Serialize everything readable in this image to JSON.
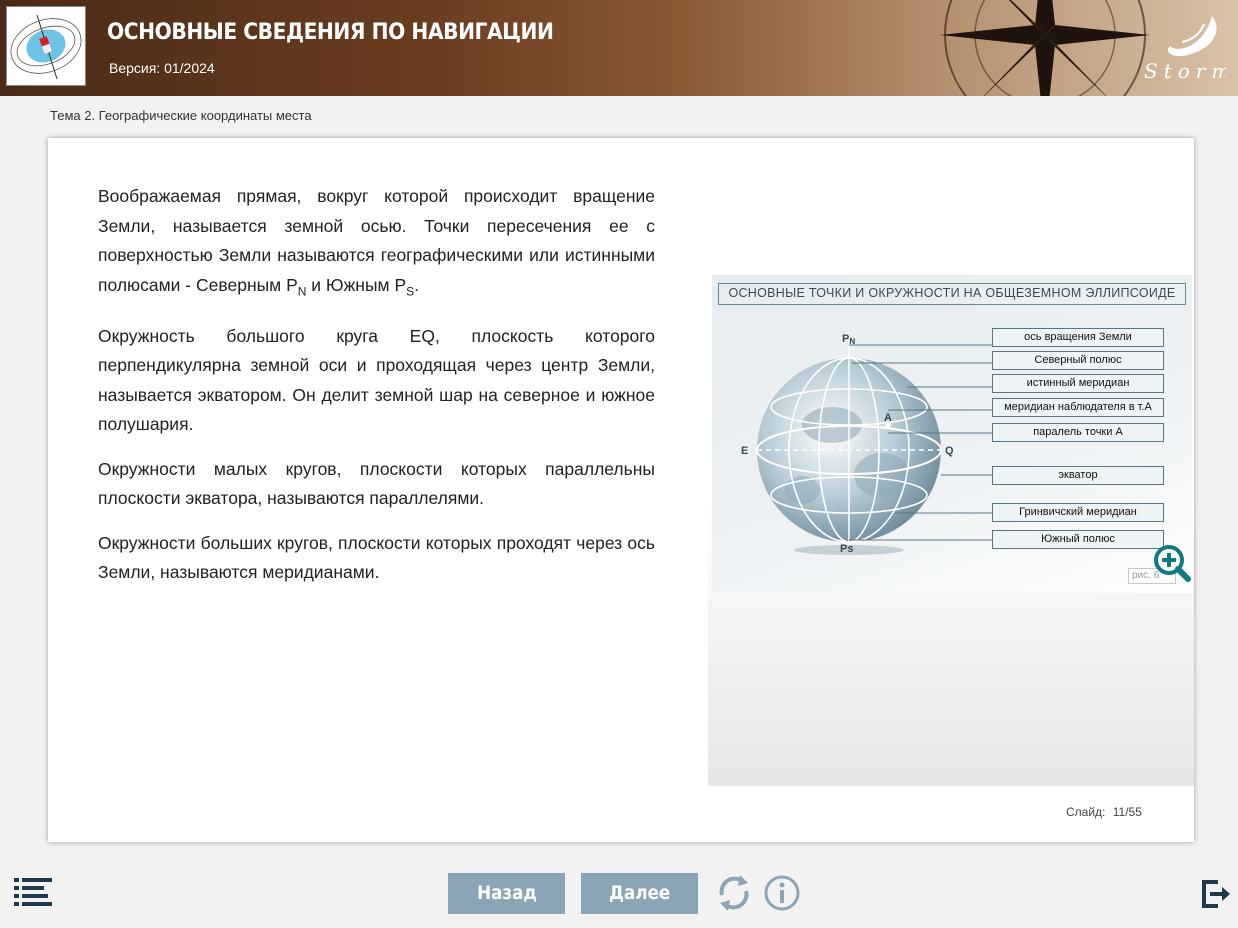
{
  "header": {
    "title": "ОСНОВНЫЕ СВЕДЕНИЯ ПО НАВИГАЦИИ",
    "version": "Версия: 01/2024",
    "brand": "Storm"
  },
  "topic": "Тема 2. Географические координаты места",
  "content": {
    "p1_text": "Воображаемая прямая, вокруг которой происходит вращение Земли, называется земной осью. Точки пересечения ее с поверхностью Земли называются географическими или истинными полюсами - Северным P",
    "p1_sub1": "N",
    "p1_mid": " и Южным P",
    "p1_sub2": "S",
    "p1_end": ".",
    "p2": "Окружность большого круга EQ, плоскость которого перпендикулярна земной оси и проходящая через центр Земли, называется экватором. Он делит земной шар на северное и южное полушария.",
    "p3": "Окружности малых кругов, плоскости которых параллельны плоскости экватора, называются параллелями.",
    "p4": "Окружности больших кругов, плоскости которых проходят через ось Земли, называются меридианами."
  },
  "figure": {
    "title": "ОСНОВНЫЕ ТОЧКИ И ОКРУЖНОСТИ НА ОБЩЕЗЕМНОМ ЭЛЛИПСОИДЕ",
    "points": {
      "pn": "P",
      "pn_sub": "N",
      "ps": "Ps",
      "a": "A",
      "e": "E",
      "q": "Q"
    },
    "labels": [
      "ось вращения Земли",
      "Северный полюс",
      "истинный меридиан",
      "меридиан наблюдателя в т.А",
      "паралель точки А",
      "экватор",
      "Гринвичский меридиан",
      "Южный полюс"
    ],
    "caption": "рис. 6"
  },
  "slide": {
    "label": "Слайд:",
    "current": "11",
    "total": "55"
  },
  "nav": {
    "back": "Назад",
    "next": "Далее"
  },
  "colors": {
    "nav_button": "#8ba5b6",
    "zoom_icon": "#0f7a80",
    "icon_gray": "#8ba5b6",
    "dark_icon": "#1d3a4e"
  },
  "icons": {
    "menu": "menu-list-icon",
    "reload": "reload-icon",
    "info": "info-icon",
    "exit": "exit-icon",
    "zoom": "zoom-in-icon"
  }
}
